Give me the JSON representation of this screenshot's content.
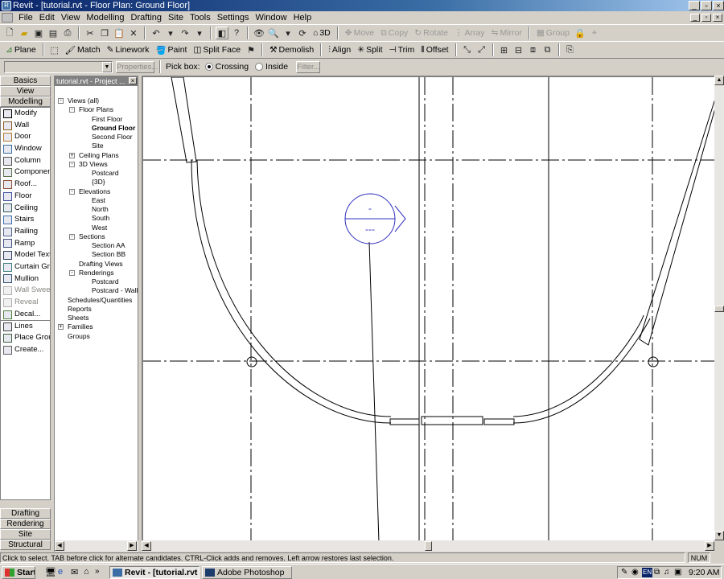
{
  "window": {
    "title": "Revit - [tutorial.rvt - Floor Plan: Ground Floor]"
  },
  "menu": [
    "File",
    "Edit",
    "View",
    "Modelling",
    "Drafting",
    "Site",
    "Tools",
    "Settings",
    "Window",
    "Help"
  ],
  "toolbar1": {
    "view_3d": "3D",
    "move": "Move",
    "copy": "Copy",
    "rotate": "Rotate",
    "array": "Array",
    "mirror": "Mirror",
    "group": "Group"
  },
  "toolbar2": {
    "plane": "Plane",
    "match": "Match",
    "linework": "Linework",
    "paint": "Paint",
    "split_face": "Split Face",
    "demolish": "Demolish",
    "align": "Align",
    "split": "Split",
    "trim": "Trim",
    "offset": "Offset"
  },
  "options": {
    "properties": "Properties...",
    "pick_box": "Pick box:",
    "crossing": "Crossing",
    "inside": "Inside",
    "filter": "Filter..."
  },
  "design_bar": {
    "top_tabs": [
      "Basics",
      "View",
      "Modelling"
    ],
    "items": [
      {
        "label": "Modify",
        "icon": "arrow-cursor-icon",
        "enabled": true
      },
      {
        "label": "Wall",
        "icon": "wall-icon",
        "enabled": true
      },
      {
        "label": "Door",
        "icon": "door-icon",
        "enabled": true
      },
      {
        "label": "Window",
        "icon": "window-icon",
        "enabled": true
      },
      {
        "label": "Column",
        "icon": "column-icon",
        "enabled": true
      },
      {
        "label": "Component",
        "icon": "component-icon",
        "enabled": true
      },
      {
        "label": "Roof...",
        "icon": "roof-icon",
        "enabled": true
      },
      {
        "label": "Floor",
        "icon": "floor-icon",
        "enabled": true
      },
      {
        "label": "Ceiling",
        "icon": "ceiling-icon",
        "enabled": true
      },
      {
        "label": "Stairs",
        "icon": "stairs-icon",
        "enabled": true
      },
      {
        "label": "Railing",
        "icon": "railing-icon",
        "enabled": true
      },
      {
        "label": "Ramp",
        "icon": "ramp-icon",
        "enabled": true
      },
      {
        "label": "Model Text",
        "icon": "text-icon",
        "enabled": true
      },
      {
        "label": "Curtain Grid",
        "icon": "curtain-grid-icon",
        "enabled": true
      },
      {
        "label": "Mullion",
        "icon": "mullion-icon",
        "enabled": true
      },
      {
        "label": "Wall Sweep",
        "icon": "wall-sweep-icon",
        "enabled": false
      },
      {
        "label": "Reveal",
        "icon": "reveal-icon",
        "enabled": false
      },
      {
        "label": "Decal...",
        "icon": "decal-icon",
        "enabled": true
      },
      {
        "label": "Lines",
        "icon": "lines-icon",
        "enabled": true
      },
      {
        "label": "Place Group",
        "icon": "group-icon",
        "enabled": true
      },
      {
        "label": "Create...",
        "icon": "create-icon",
        "enabled": true
      }
    ],
    "bottom_tabs": [
      "Drafting",
      "Rendering",
      "Site",
      "Structural"
    ]
  },
  "browser": {
    "title": "tutorial.rvt - Project ...",
    "tree": [
      {
        "label": "Views (all)",
        "level": 0,
        "toggle": "-",
        "bold": false
      },
      {
        "label": "Floor Plans",
        "level": 1,
        "toggle": "-",
        "bold": false
      },
      {
        "label": "First Floor",
        "level": 2,
        "toggle": "",
        "bold": false
      },
      {
        "label": "Ground Floor",
        "level": 2,
        "toggle": "",
        "bold": true
      },
      {
        "label": "Second Floor",
        "level": 2,
        "toggle": "",
        "bold": false
      },
      {
        "label": "Site",
        "level": 2,
        "toggle": "",
        "bold": false
      },
      {
        "label": "Ceiling Plans",
        "level": 1,
        "toggle": "+",
        "bold": false
      },
      {
        "label": "3D Views",
        "level": 1,
        "toggle": "-",
        "bold": false
      },
      {
        "label": "Postcard",
        "level": 2,
        "toggle": "",
        "bold": false
      },
      {
        "label": "{3D}",
        "level": 2,
        "toggle": "",
        "bold": false
      },
      {
        "label": "Elevations",
        "level": 1,
        "toggle": "-",
        "bold": false
      },
      {
        "label": "East",
        "level": 2,
        "toggle": "",
        "bold": false
      },
      {
        "label": "North",
        "level": 2,
        "toggle": "",
        "bold": false
      },
      {
        "label": "South",
        "level": 2,
        "toggle": "",
        "bold": false
      },
      {
        "label": "West",
        "level": 2,
        "toggle": "",
        "bold": false
      },
      {
        "label": "Sections",
        "level": 1,
        "toggle": "-",
        "bold": false
      },
      {
        "label": "Section AA",
        "level": 2,
        "toggle": "",
        "bold": false
      },
      {
        "label": "Section BB",
        "level": 2,
        "toggle": "",
        "bold": false
      },
      {
        "label": "Drafting Views",
        "level": 1,
        "toggle": "",
        "bold": false
      },
      {
        "label": "Renderings",
        "level": 1,
        "toggle": "-",
        "bold": false
      },
      {
        "label": "Postcard",
        "level": 2,
        "toggle": "",
        "bold": false
      },
      {
        "label": "Postcard - Wall",
        "level": 2,
        "toggle": "",
        "bold": false
      },
      {
        "label": "Schedules/Quantities",
        "level": 0,
        "toggle": "",
        "bold": false
      },
      {
        "label": "Reports",
        "level": 0,
        "toggle": "",
        "bold": false
      },
      {
        "label": "Sheets",
        "level": 0,
        "toggle": "",
        "bold": false
      },
      {
        "label": "Families",
        "level": 0,
        "toggle": "+",
        "bold": false
      },
      {
        "label": "Groups",
        "level": 0,
        "toggle": "",
        "bold": false
      }
    ]
  },
  "canvas": {
    "elevation_top": "-",
    "elevation_bottom": "---"
  },
  "status": {
    "message": "Click to select. TAB before click for alternate candidates. CTRL-Click adds and removes. Left arrow restores last selection.",
    "num": "NUM"
  },
  "taskbar": {
    "start": "Start",
    "tasks": [
      "Revit - [tutorial.rvt ...",
      "Adobe Photoshop"
    ],
    "lang": "EN",
    "clock": "9:20 AM"
  }
}
